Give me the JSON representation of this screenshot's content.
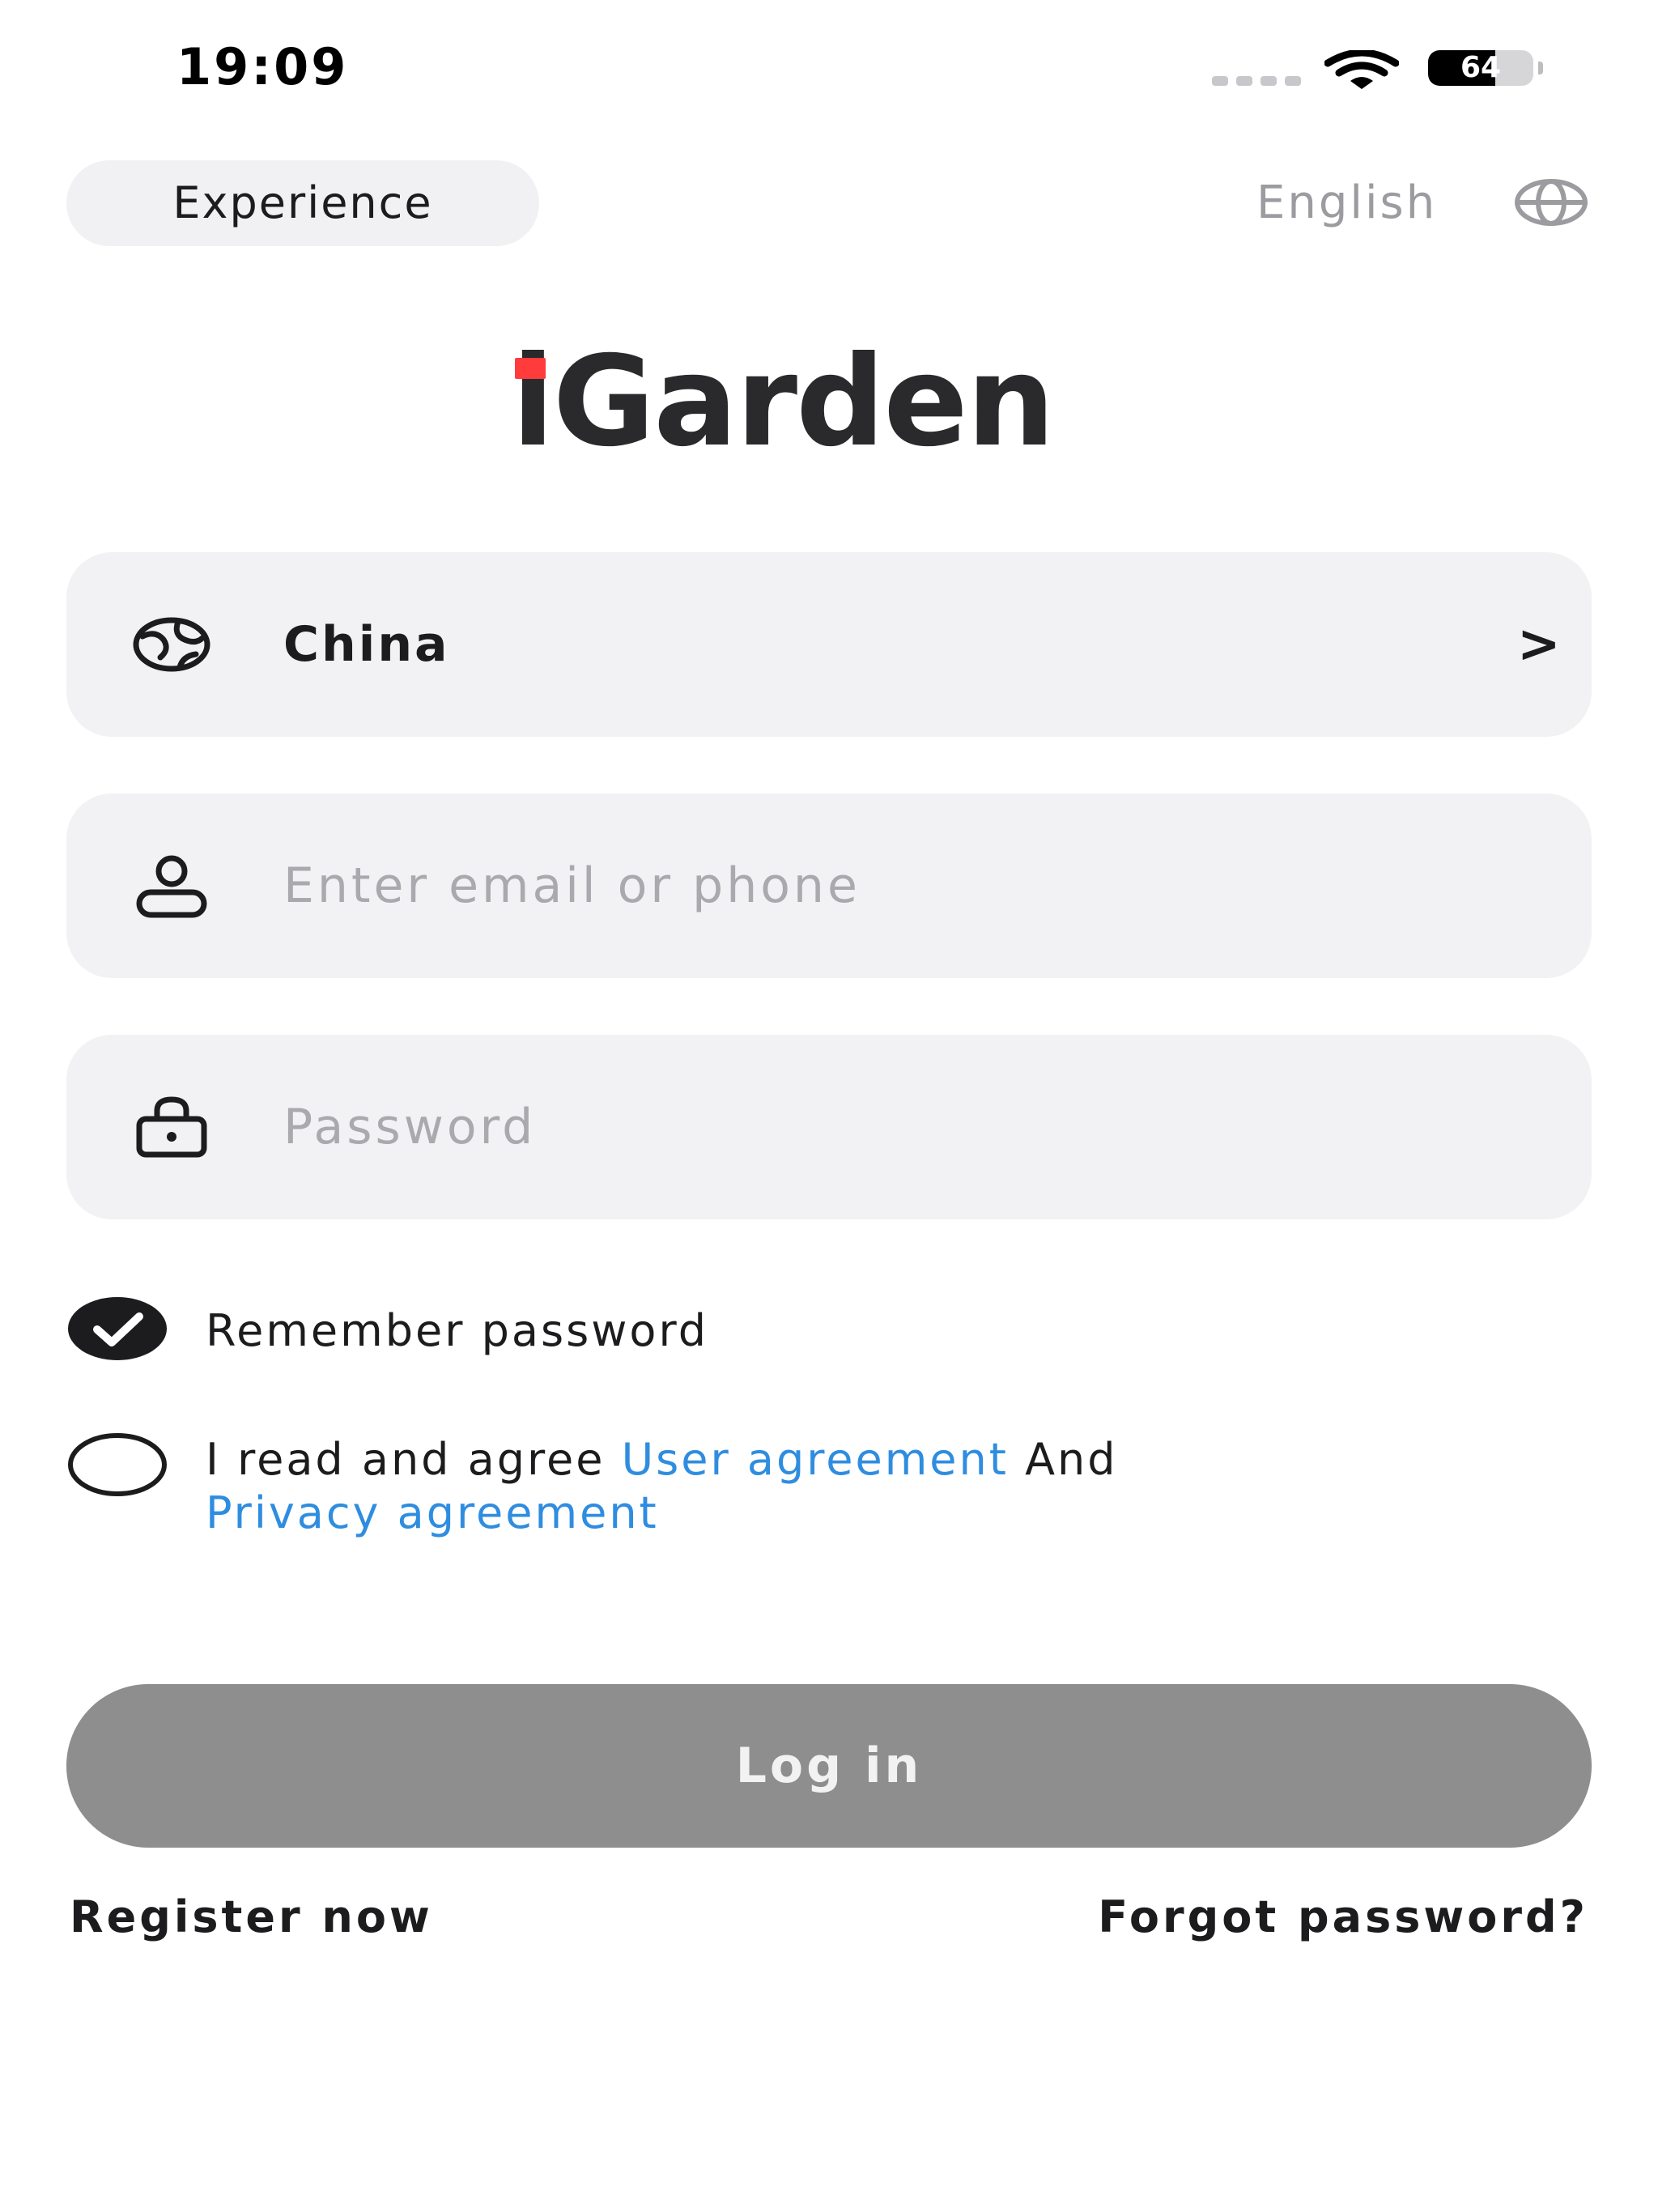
{
  "status_bar": {
    "time": "19:09",
    "battery_level": "64",
    "battery_percent": 64
  },
  "header": {
    "experience_label": "Experience",
    "language_label": "English",
    "language_icon": "globe-icon"
  },
  "logo": {
    "text": "iGarden",
    "accent_color": "#ff3b3b"
  },
  "form": {
    "region": {
      "icon": "globe-icon",
      "value": "China",
      "chevron": ">"
    },
    "account": {
      "icon": "user-icon",
      "placeholder": "Enter email or phone",
      "value": ""
    },
    "password": {
      "icon": "lock-icon",
      "placeholder": "Password",
      "value": ""
    }
  },
  "options": {
    "remember_label": "Remember password",
    "remember_checked": true,
    "agree_prefix": "I read and agree ",
    "user_agreement_link": "User agreement",
    "agree_and": " And",
    "privacy_agreement_link": "Privacy agreement",
    "agree_checked": false
  },
  "actions": {
    "login_label": "Log in",
    "register_label": "Register now",
    "forgot_label": "Forgot password?"
  },
  "colors": {
    "link": "#2f8de0",
    "login_disabled_bg": "#8e8e8e",
    "field_bg": "#f2f2f4"
  }
}
